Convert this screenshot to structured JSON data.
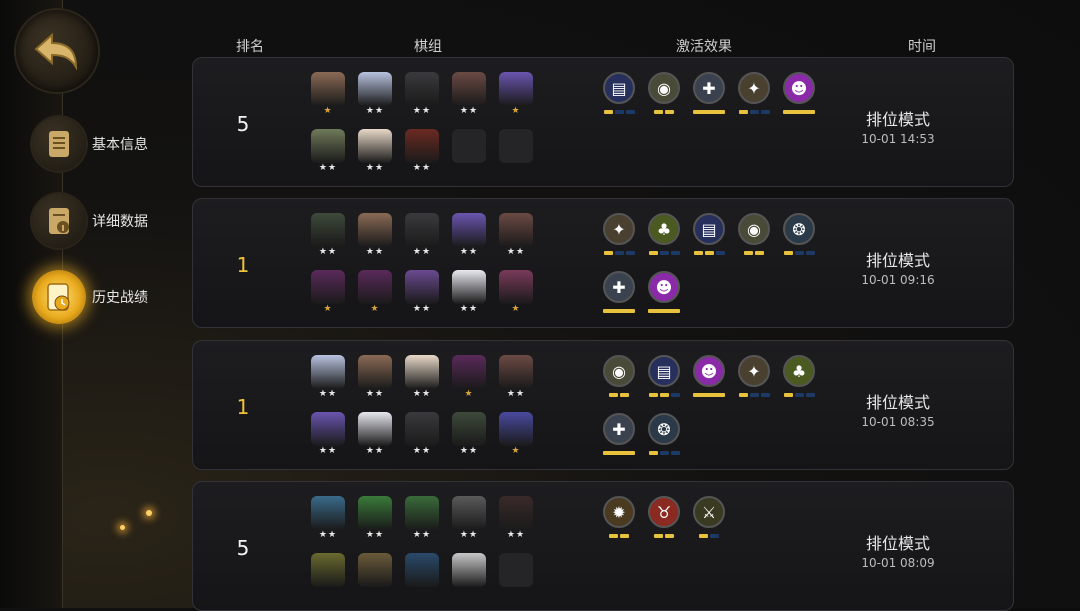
{
  "header": {
    "rank": "排名",
    "lineup": "棋组",
    "synergy": "激活效果",
    "time": "时间"
  },
  "nav": {
    "items": [
      {
        "label": "基本信息",
        "active": false
      },
      {
        "label": "详细数据",
        "active": false
      },
      {
        "label": "历史战绩",
        "active": true
      }
    ]
  },
  "colors": {
    "gold": "#f0c23a",
    "bar_on": "#e8c23c",
    "bar_off": "#1d3a66"
  },
  "matches": [
    {
      "rank": "5",
      "mode": "排位模式",
      "time": "10-01 14:53",
      "pieces": [
        {
          "color": "#8a6a55",
          "stars": 1
        },
        {
          "color": "#b9c3e0",
          "stars": 2
        },
        {
          "color": "#3a3a3e",
          "stars": 2
        },
        {
          "color": "#6b4a44",
          "stars": 2
        },
        {
          "color": "#6a55b0",
          "stars": 1
        },
        {
          "color": "#6f7a5a",
          "stars": 2
        },
        {
          "color": "#e8d9c8",
          "stars": 2
        },
        {
          "color": "#6b2a22",
          "stars": 2
        },
        {
          "color": "",
          "stars": 0
        },
        {
          "color": "",
          "stars": 0
        }
      ],
      "synergies": [
        {
          "icon": "tablet-icon",
          "color": "#27305c",
          "glyph": "▤",
          "bar": [
            1,
            0,
            0
          ]
        },
        {
          "icon": "shell-icon",
          "color": "#4a4a38",
          "glyph": "◉",
          "bar": [
            1,
            1
          ]
        },
        {
          "icon": "cross-icon",
          "color": "#3a4250",
          "glyph": "✚",
          "bar": [
            2
          ]
        },
        {
          "icon": "bird-icon",
          "color": "#4a4030",
          "glyph": "✦",
          "bar": [
            1,
            0,
            0
          ]
        },
        {
          "icon": "demon-icon",
          "color": "#8a2aa8",
          "glyph": "☻",
          "bar": [
            2
          ]
        }
      ]
    },
    {
      "rank": "1",
      "mode": "排位模式",
      "time": "10-01 09:16",
      "pieces": [
        {
          "color": "#3e4a3a",
          "stars": 2
        },
        {
          "color": "#8a6a55",
          "stars": 2
        },
        {
          "color": "#3a3a3e",
          "stars": 2
        },
        {
          "color": "#6a55b0",
          "stars": 2
        },
        {
          "color": "#6b4a44",
          "stars": 2
        },
        {
          "color": "#5a2a5a",
          "stars": 1
        },
        {
          "color": "#5a2a5a",
          "stars": 1
        },
        {
          "color": "#6a4a90",
          "stars": 2
        },
        {
          "color": "#e8e8f0",
          "stars": 2
        },
        {
          "color": "#7a3a5a",
          "stars": 1
        }
      ],
      "synergies": [
        {
          "icon": "bird-icon",
          "color": "#4a4030",
          "glyph": "✦",
          "bar": [
            1,
            0,
            0
          ]
        },
        {
          "icon": "tree-icon",
          "color": "#4a5a20",
          "glyph": "♣",
          "bar": [
            1,
            0,
            0
          ]
        },
        {
          "icon": "tablet-icon",
          "color": "#27305c",
          "glyph": "▤",
          "bar": [
            1,
            1,
            0
          ]
        },
        {
          "icon": "shell-icon",
          "color": "#4a4a38",
          "glyph": "◉",
          "bar": [
            1,
            1
          ]
        },
        {
          "icon": "orb-icon",
          "color": "#2a3a48",
          "glyph": "❂",
          "bar": [
            1,
            0,
            0
          ]
        },
        {
          "icon": "cross-icon",
          "color": "#3a4250",
          "glyph": "✚",
          "bar": [
            2
          ]
        },
        {
          "icon": "demon-icon",
          "color": "#8a2aa8",
          "glyph": "☻",
          "bar": [
            2
          ]
        }
      ]
    },
    {
      "rank": "1",
      "mode": "排位模式",
      "time": "10-01 08:35",
      "pieces": [
        {
          "color": "#b9c3e0",
          "stars": 2
        },
        {
          "color": "#8a6a55",
          "stars": 2
        },
        {
          "color": "#e8d9c8",
          "stars": 2
        },
        {
          "color": "#5a2a5a",
          "stars": 1
        },
        {
          "color": "#6b4a44",
          "stars": 2
        },
        {
          "color": "#6a55b0",
          "stars": 2
        },
        {
          "color": "#e8e8f0",
          "stars": 2
        },
        {
          "color": "#3a3a3e",
          "stars": 2
        },
        {
          "color": "#3e4a3a",
          "stars": 2
        },
        {
          "color": "#4a4aa0",
          "stars": 1
        }
      ],
      "synergies": [
        {
          "icon": "shell-icon",
          "color": "#4a4a38",
          "glyph": "◉",
          "bar": [
            1,
            1
          ]
        },
        {
          "icon": "tablet-icon",
          "color": "#27305c",
          "glyph": "▤",
          "bar": [
            1,
            1,
            0
          ]
        },
        {
          "icon": "demon-icon",
          "color": "#8a2aa8",
          "glyph": "☻",
          "bar": [
            2
          ]
        },
        {
          "icon": "bird-icon",
          "color": "#4a4030",
          "glyph": "✦",
          "bar": [
            1,
            0,
            0
          ]
        },
        {
          "icon": "tree-icon",
          "color": "#4a5a20",
          "glyph": "♣",
          "bar": [
            1,
            0,
            0
          ]
        },
        {
          "icon": "cross-icon",
          "color": "#3a4250",
          "glyph": "✚",
          "bar": [
            2
          ]
        },
        {
          "icon": "orb-icon",
          "color": "#2a3a48",
          "glyph": "❂",
          "bar": [
            1,
            0,
            0
          ]
        }
      ]
    },
    {
      "rank": "5",
      "mode": "排位模式",
      "time": "10-01 08:09",
      "pieces": [
        {
          "color": "#3a6a8a",
          "stars": 2
        },
        {
          "color": "#3a7a3a",
          "stars": 2
        },
        {
          "color": "#3a6a3a",
          "stars": 2
        },
        {
          "color": "#5a5a5a",
          "stars": 2
        },
        {
          "color": "#3a2a2a",
          "stars": 2
        },
        {
          "color": "#6a6a30",
          "stars": 0
        },
        {
          "color": "#6a5a3a",
          "stars": 0
        },
        {
          "color": "#2a4a6a",
          "stars": 0
        },
        {
          "color": "#c8c8c8",
          "stars": 0
        },
        {
          "color": "",
          "stars": 0
        }
      ],
      "synergies": [
        {
          "icon": "gear-icon",
          "color": "#4a3a20",
          "glyph": "✹",
          "bar": [
            1,
            1
          ]
        },
        {
          "icon": "bull-icon",
          "color": "#8a2a20",
          "glyph": "♉",
          "bar": [
            1,
            1
          ]
        },
        {
          "icon": "claw-icon",
          "color": "#3a3a22",
          "glyph": "⚔",
          "bar": [
            1,
            0
          ]
        }
      ]
    }
  ]
}
